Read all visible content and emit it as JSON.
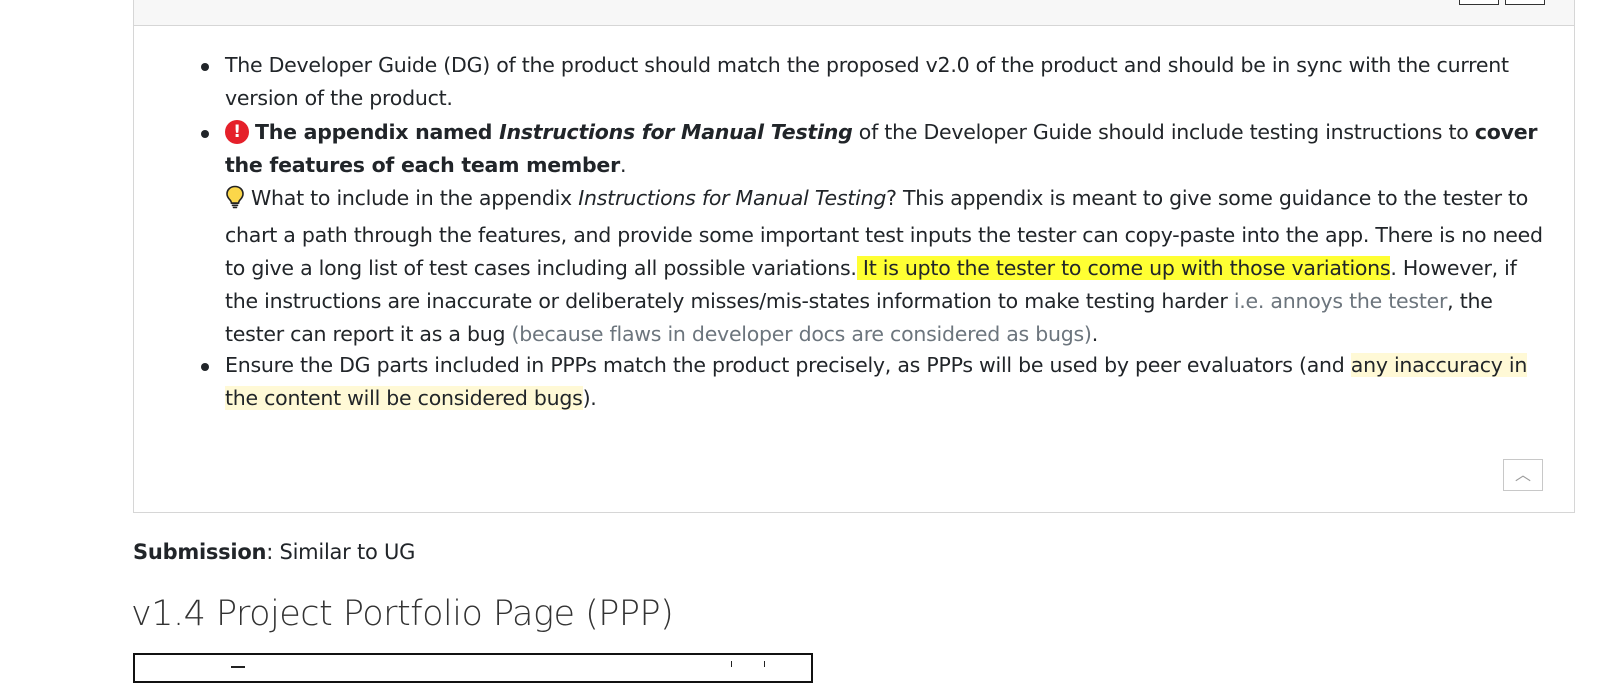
{
  "bullets": {
    "b1": {
      "text": "The Developer Guide (DG) of the product should match the proposed v2.0 of the product and should be in sync with the current version of the product."
    },
    "b2": {
      "icon": "exclamation-circle-icon",
      "icon_color": "#e5202a",
      "bold1": "The appendix named ",
      "bold_italic": "Instructions for Manual Testing",
      "mid": " of the Developer Guide should include testing instructions to ",
      "bold2": "cover the features of each team member",
      "end": "."
    },
    "tip": {
      "icon": "lightbulb-icon",
      "t1": "What to include in the appendix ",
      "t1_italic": "Instructions for Manual Testing",
      "t2": "? This appendix is meant to give some guidance to the tester to chart a path through the features, and provide some important test inputs the tester can copy-paste into the app. There is no need to give a long list of test cases including all possible variations.",
      "highlight": " It is upto the tester to come up with those variations",
      "t3": ". However, if the instructions are inaccurate or deliberately misses/mis-states information to make testing harder  ",
      "muted1": "i.e. annoys the tester",
      "t4": ", the tester can report it as a bug  ",
      "muted2": "(because flaws in developer docs are considered as bugs)",
      "t5": ".",
      "highlight_color": "#ffff33"
    },
    "b3": {
      "t1": "Ensure the DG parts included in PPPs match the product precisely, as PPPs will be used by peer evaluators (and ",
      "highlight": "any inaccuracy in the content will be considered bugs",
      "t2": ").",
      "highlight_color": "#fff9d6"
    }
  },
  "scroll_top_icon": "chevron-up-icon",
  "scroll_top_glyph": "︿",
  "alert_glyph": "!",
  "submission": {
    "label": "Submission",
    "text": ": Similar to UG"
  },
  "section_title": "v1.4 Project Portfolio Page (PPP)"
}
